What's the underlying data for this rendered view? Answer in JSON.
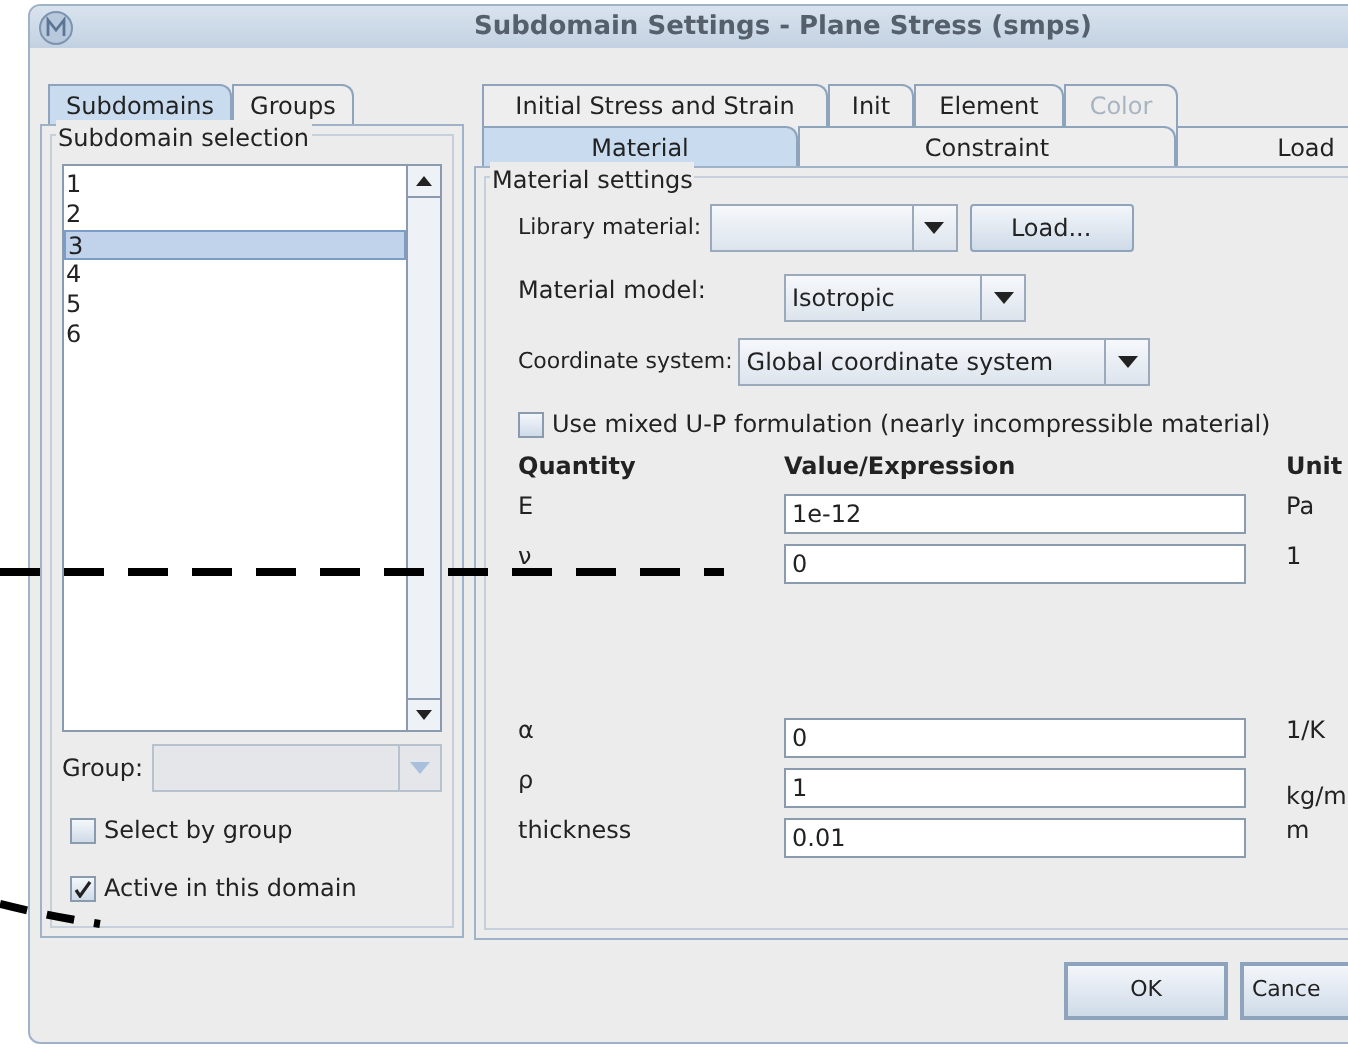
{
  "window": {
    "title": "Subdomain Settings - Plane Stress (smps)"
  },
  "left_tabs": [
    {
      "label": "Subdomains",
      "selected": true
    },
    {
      "label": "Groups",
      "selected": false
    }
  ],
  "subdomain_selection": {
    "title": "Subdomain selection",
    "items": [
      {
        "label": "1",
        "selected": false
      },
      {
        "label": "2",
        "selected": false
      },
      {
        "label": "3",
        "selected": true
      },
      {
        "label": "4",
        "selected": false
      },
      {
        "label": "5",
        "selected": false
      },
      {
        "label": "6",
        "selected": false
      }
    ],
    "group": {
      "label": "Group:",
      "disabled": true
    },
    "checkboxes": [
      {
        "label": "Select by group",
        "checked": false
      },
      {
        "label": "Active in this domain",
        "checked": true
      }
    ]
  },
  "tabs_row_1": [
    {
      "label": "Initial Stress and Strain",
      "selected": false,
      "disabled": false
    },
    {
      "label": "Init",
      "selected": false,
      "disabled": false
    },
    {
      "label": "Element",
      "selected": false,
      "disabled": false
    },
    {
      "label": "Color",
      "selected": false,
      "disabled": true
    }
  ],
  "tabs_row_2": [
    {
      "label": "Material",
      "selected": true,
      "disabled": false
    },
    {
      "label": "Constraint",
      "selected": false,
      "disabled": false
    },
    {
      "label": "Load",
      "selected": false,
      "disabled": false
    }
  ],
  "material_settings": {
    "title": "Material settings",
    "library_material": {
      "label": "Library material:",
      "button": "Load..."
    },
    "material_model": {
      "label": "Material model:",
      "value": "Isotropic"
    },
    "coordinate_system": {
      "label": "Coordinate system:",
      "value": "Global coordinate system"
    },
    "mixed_formulation": {
      "label": "Use mixed U-P formulation (nearly incompressible material)",
      "checked": false
    },
    "columns": [
      "Quantity",
      "Value/Expression",
      "Unit"
    ],
    "rows": [
      {
        "quantity": "E",
        "value": "1e-12",
        "unit": "Pa"
      },
      {
        "quantity": "ν",
        "value": "0",
        "unit": "1"
      },
      {
        "quantity": "α",
        "value": "0",
        "unit": "1/K"
      },
      {
        "quantity": "ρ",
        "value": "1",
        "unit": "kg/m"
      },
      {
        "quantity": "thickness",
        "value": "0.01",
        "unit": "m"
      }
    ]
  },
  "buttons": [
    "OK",
    "Cance"
  ]
}
